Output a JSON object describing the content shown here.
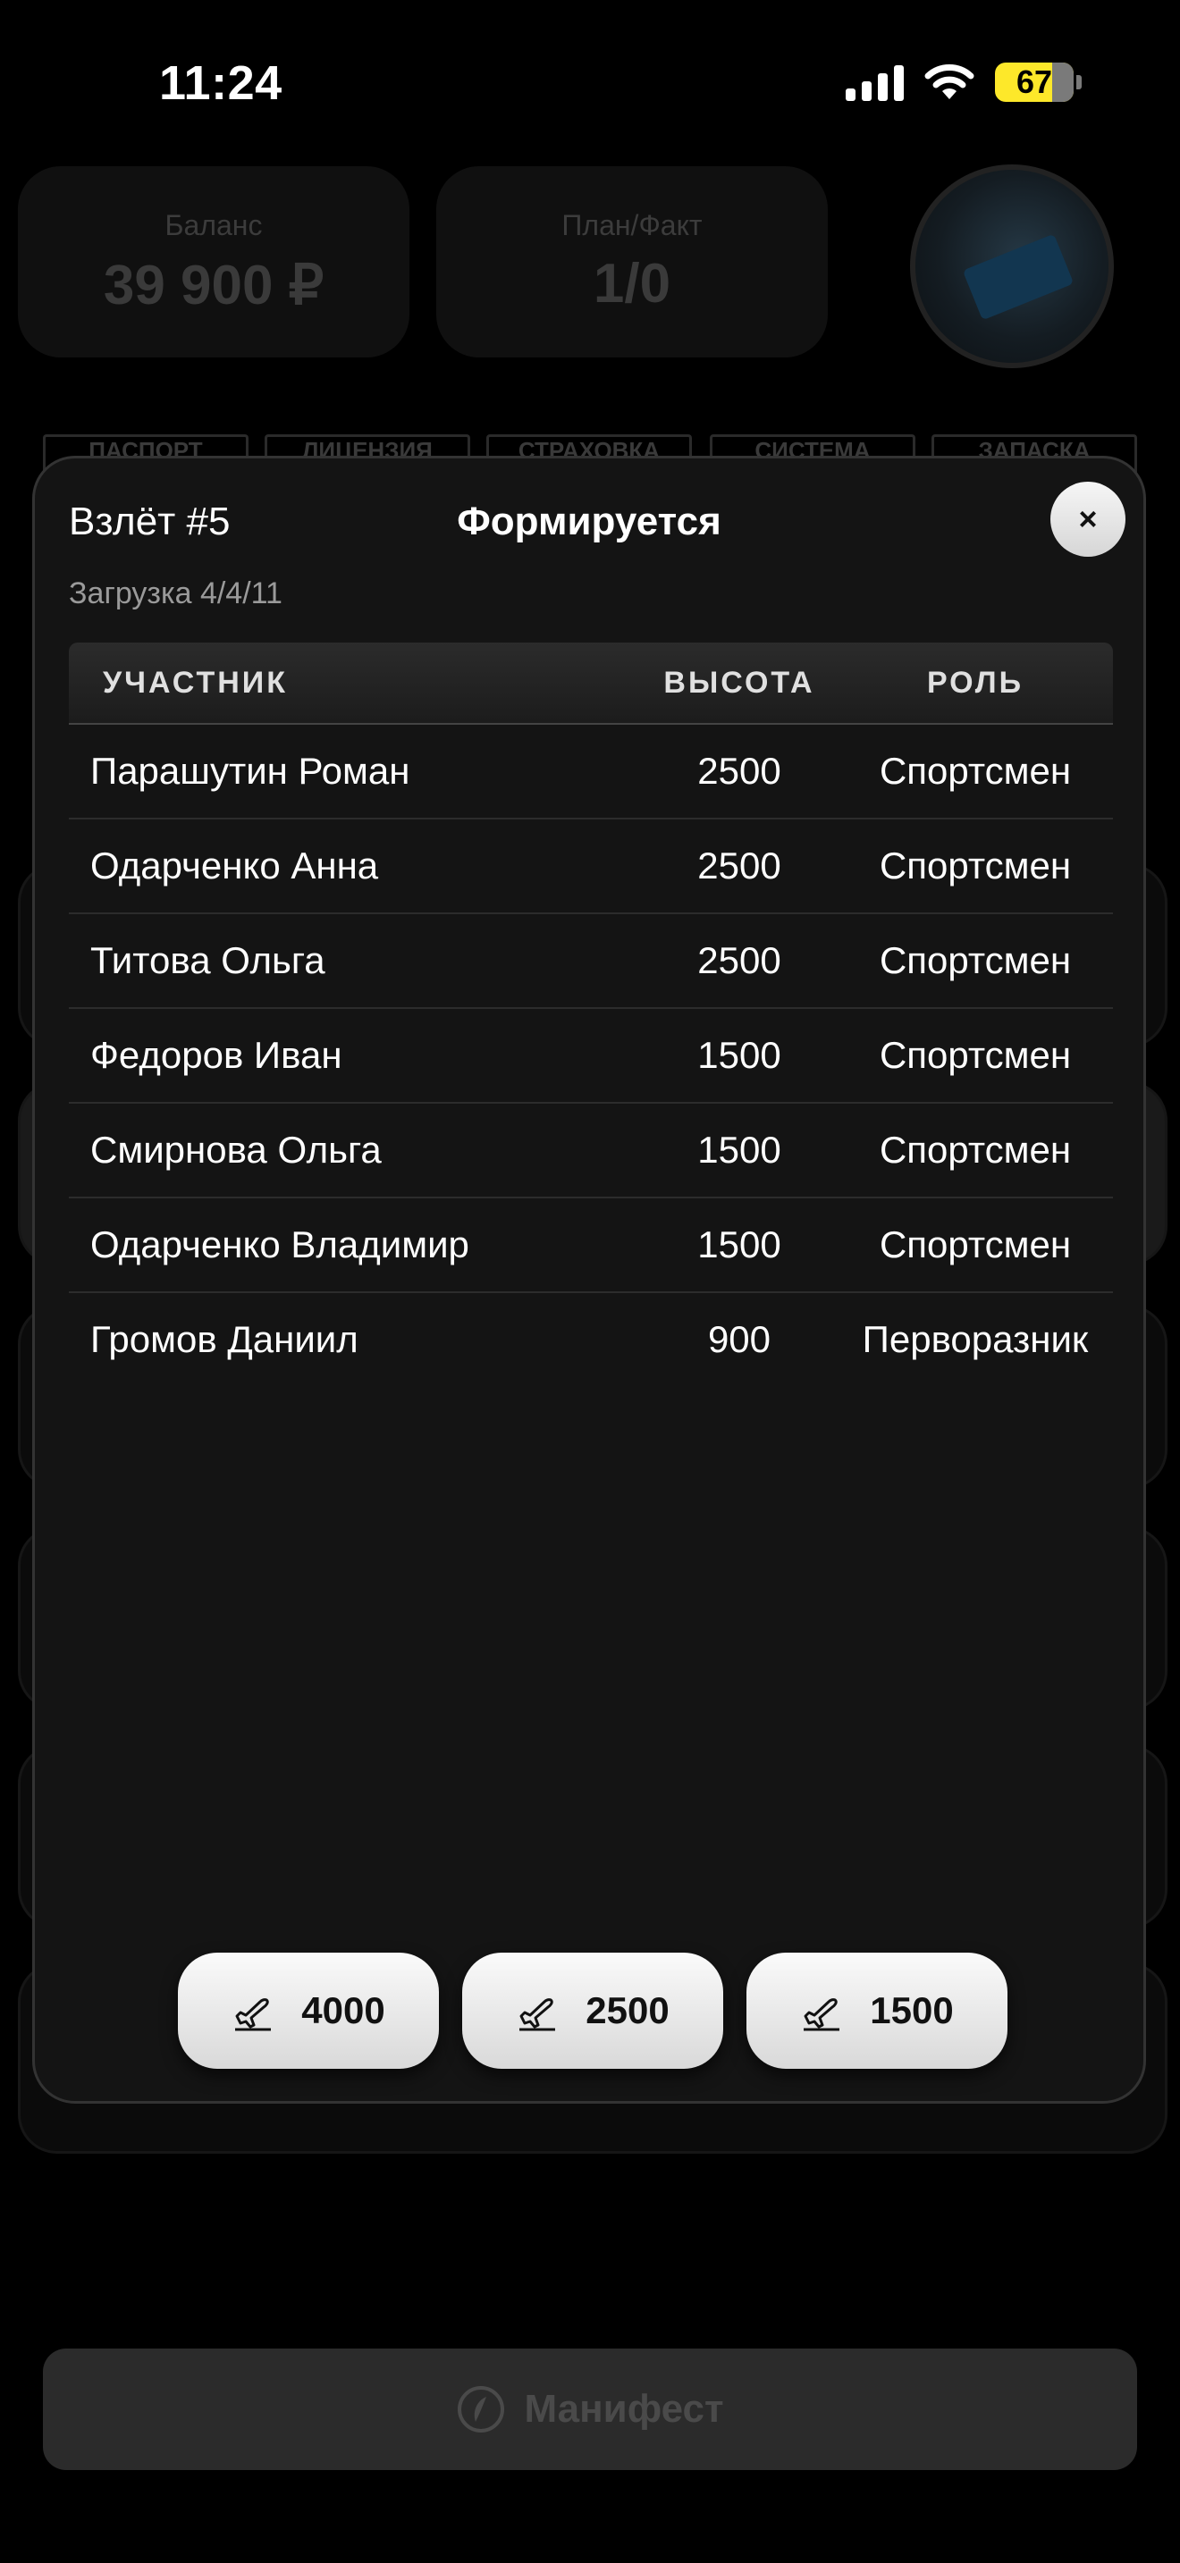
{
  "status_bar": {
    "time": "11:24",
    "battery": "67",
    "icons": [
      "signal-icon",
      "wifi-icon",
      "battery-icon"
    ]
  },
  "background": {
    "balance_label": "Баланс",
    "balance_value": "39 900 ₽",
    "plan_label": "План/Факт",
    "plan_value": "1/0",
    "doc_tabs": [
      "ПАСПОРТ",
      "ЛИЦЕНЗИЯ",
      "СТРАХОВКА",
      "СИСТЕМА",
      "ЗАПАСКА"
    ],
    "manifest_label": "Манифест"
  },
  "modal": {
    "title": "Взлёт #5",
    "status": "Формируется",
    "close_label": "×",
    "subtitle": "Загрузка 4/4/11",
    "columns": {
      "name": "УЧАСТНИК",
      "altitude": "ВЫСОТА",
      "role": "РОЛЬ"
    },
    "rows": [
      {
        "name": "Парашутин Роман",
        "altitude": "2500",
        "role": "Спортсмен"
      },
      {
        "name": "Одарченко Анна",
        "altitude": "2500",
        "role": "Спортсмен"
      },
      {
        "name": "Титова Ольга",
        "altitude": "2500",
        "role": "Спортсмен"
      },
      {
        "name": "Федоров Иван",
        "altitude": "1500",
        "role": "Спортсмен"
      },
      {
        "name": "Смирнова Ольга",
        "altitude": "1500",
        "role": "Спортсмен"
      },
      {
        "name": "Одарченко Владимир",
        "altitude": "1500",
        "role": "Спортсмен"
      },
      {
        "name": "Громов Даниил",
        "altitude": "900",
        "role": "Перворазник"
      }
    ],
    "altitude_buttons": [
      {
        "label": "4000",
        "icon": "plane-takeoff-icon"
      },
      {
        "label": "2500",
        "icon": "plane-takeoff-icon"
      },
      {
        "label": "1500",
        "icon": "plane-takeoff-icon"
      }
    ]
  },
  "colors": {
    "battery": "#fde82a",
    "modal_bg": "#141414",
    "button_bg": "#e8e8e8"
  }
}
